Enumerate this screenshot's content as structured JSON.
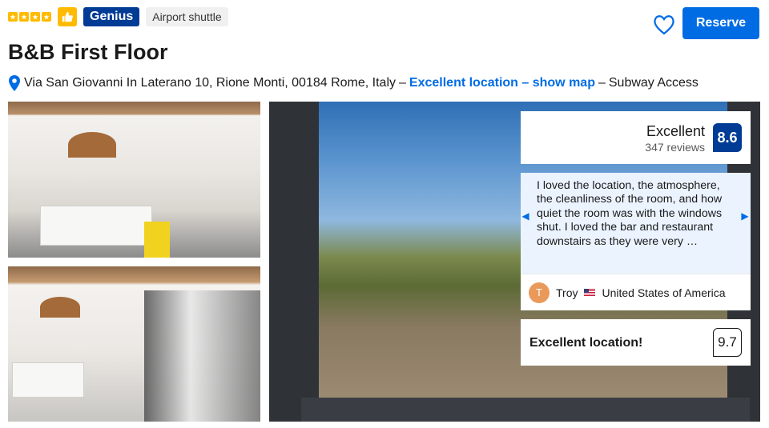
{
  "header": {
    "stars": 4,
    "genius_label": "Genius",
    "shuttle_label": "Airport shuttle",
    "reserve_label": "Reserve"
  },
  "property": {
    "name": "B&B First Floor",
    "address": "Via San Giovanni In Laterano 10, Rione Monti, 00184 Rome, Italy",
    "separator_1": "–",
    "location_link": "Excellent location – show map",
    "separator_2": "–",
    "address_suffix": "Subway Access"
  },
  "score": {
    "word": "Excellent",
    "reviews": "347 reviews",
    "value": "8.6"
  },
  "review": {
    "text": "I loved the location, the atmosphere, the cleanliness of the room, and how quiet the room was with the windows shut. I loved the bar and restaurant downstairs as they were very …",
    "avatar_initial": "T",
    "reviewer": "Troy",
    "country": "United States of America"
  },
  "location_score": {
    "label": "Excellent location!",
    "value": "9.7"
  },
  "colors": {
    "brand_blue": "#003b95",
    "action_blue": "#006ce4",
    "star_yellow": "#febb02"
  }
}
